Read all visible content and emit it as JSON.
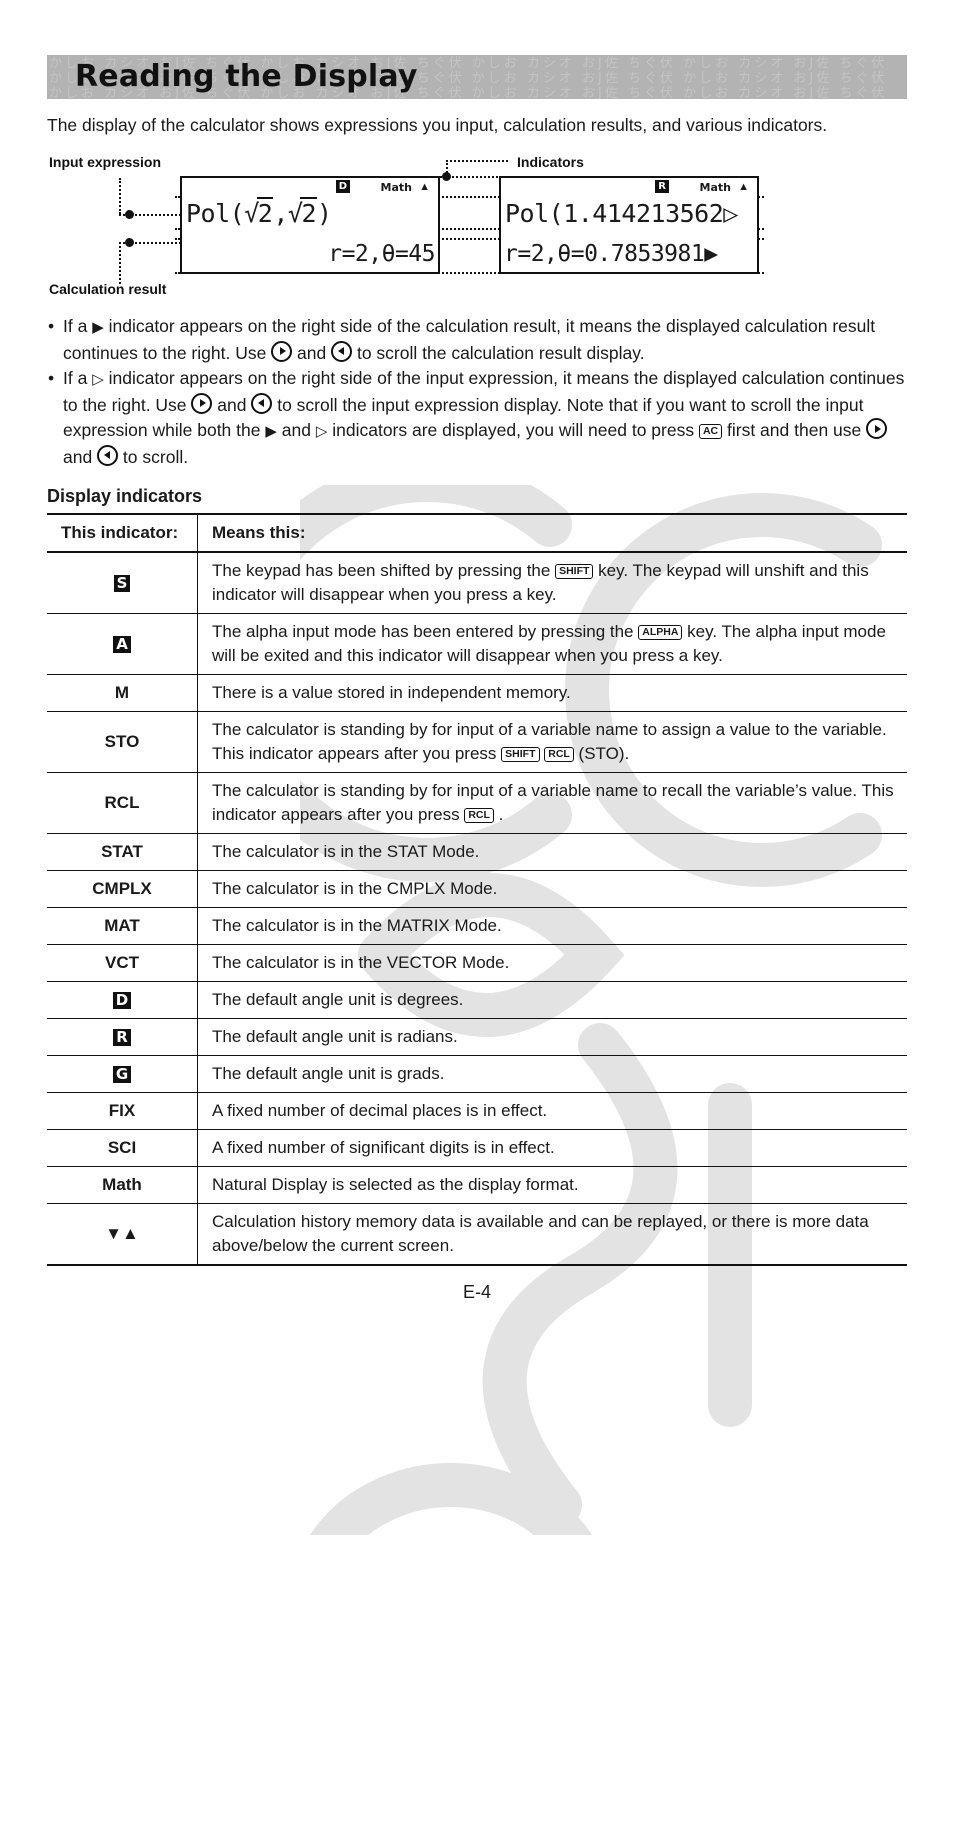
{
  "header": {
    "title": "Reading the Display",
    "kana_pattern": "かしお カシオ おJ佐 ちぐ伏 かしお カシオ おJ佐 ちぐ伏 かしお カシオ おJ佐 ちぐ伏 かしお カシオ おJ佐 ちぐ伏 かしお カシオ おJ佐 ちぐ伏 かしお カシオ おJ佐 ちぐ伏 かしお カシオ おJ佐 ちぐ伏 かしお カシオ おJ佐 ちぐ伏 かしお カシオ おJ佐 ちぐ伏 かしお カシオ おJ佐 ちぐ伏 かしお カシオ おJ佐 ちぐ伏 かしお カシオ おJ佐 ちぐ伏 かしお カシオ おJ佐 ちぐ伏"
  },
  "intro": "The display of the calculator shows expressions you input, calculation results, and various indicators.",
  "figure": {
    "label_input": "Input expression",
    "label_indicators": "Indicators",
    "label_calc_result": "Calculation result",
    "left_display": {
      "angle_indicator": "D",
      "math_indicator": "Math",
      "up_arrow": "▲",
      "expression_prefix": "Pol(",
      "radicand_1": "2",
      "separator": ",",
      "radicand_2": "2",
      "expression_suffix": ")",
      "result": "r=2,θ=45"
    },
    "right_display": {
      "angle_indicator": "R",
      "math_indicator": "Math",
      "up_arrow": "▲",
      "expression": "Pol(1.414213562",
      "expression_scroll_marker": "▷",
      "result": "r=2,θ=0.7853981",
      "result_scroll_marker": "▶"
    }
  },
  "bullets": [
    {
      "parts": [
        {
          "type": "text",
          "value": "If a "
        },
        {
          "type": "glyph",
          "value": "▶"
        },
        {
          "type": "text",
          "value": " indicator appears on the right side of the calculation result, it means the displayed calculation result continues to the right. Use "
        },
        {
          "type": "roundkey",
          "value": "right"
        },
        {
          "type": "text",
          "value": " and "
        },
        {
          "type": "roundkey",
          "value": "left"
        },
        {
          "type": "text",
          "value": " to scroll the calculation result display."
        }
      ]
    },
    {
      "parts": [
        {
          "type": "text",
          "value": "If a "
        },
        {
          "type": "glyph",
          "value": "▷"
        },
        {
          "type": "text",
          "value": " indicator appears on the right side of the input expression, it means the displayed calculation continues to the right. Use "
        },
        {
          "type": "roundkey",
          "value": "right"
        },
        {
          "type": "text",
          "value": " and "
        },
        {
          "type": "roundkey",
          "value": "left"
        },
        {
          "type": "text",
          "value": " to scroll the input expression display. Note that if you want to scroll the input expression while both the "
        },
        {
          "type": "glyph",
          "value": "▶"
        },
        {
          "type": "text",
          "value": " and "
        },
        {
          "type": "glyph",
          "value": "▷"
        },
        {
          "type": "text",
          "value": " indicators are displayed, you will need to press "
        },
        {
          "type": "keycap",
          "value": "AC"
        },
        {
          "type": "text",
          "value": " first and then use "
        },
        {
          "type": "roundkey",
          "value": "right"
        },
        {
          "type": "text",
          "value": " and "
        },
        {
          "type": "roundkey",
          "value": "left"
        },
        {
          "type": "text",
          "value": " to scroll."
        }
      ]
    }
  ],
  "section_heading": "Display indicators",
  "table": {
    "headers": {
      "col1": "This indicator:",
      "col2": "Means this:"
    },
    "rows": [
      {
        "indicator": "S",
        "style": "inverse",
        "meaning_parts": [
          {
            "type": "text",
            "value": "The keypad has been shifted by pressing the "
          },
          {
            "type": "keycap",
            "value": "SHIFT"
          },
          {
            "type": "text",
            "value": " key. The keypad will unshift and this indicator will disappear when you press a key."
          }
        ]
      },
      {
        "indicator": "A",
        "style": "inverse",
        "meaning_parts": [
          {
            "type": "text",
            "value": "The alpha input mode has been entered by pressing the "
          },
          {
            "type": "keycap",
            "value": "ALPHA"
          },
          {
            "type": "text",
            "value": " key. The alpha input mode will be exited and this indicator will disappear when you press a key."
          }
        ]
      },
      {
        "indicator": "M",
        "style": "bold",
        "meaning_parts": [
          {
            "type": "text",
            "value": "There is a value stored in independent memory."
          }
        ]
      },
      {
        "indicator": "STO",
        "style": "bold",
        "meaning_parts": [
          {
            "type": "text",
            "value": "The calculator is standing by for input of a variable name to assign a value to the variable. This indicator appears after you press "
          },
          {
            "type": "keycap",
            "value": "SHIFT"
          },
          {
            "type": "text",
            "value": " "
          },
          {
            "type": "keycap",
            "value": "RCL"
          },
          {
            "type": "text",
            "value": " (STO)."
          }
        ]
      },
      {
        "indicator": "RCL",
        "style": "bold",
        "meaning_parts": [
          {
            "type": "text",
            "value": "The calculator is standing by for input of a variable name to recall the variable’s value. This indicator appears after you press "
          },
          {
            "type": "keycap",
            "value": "RCL"
          },
          {
            "type": "text",
            "value": " ."
          }
        ]
      },
      {
        "indicator": "STAT",
        "style": "bold",
        "meaning_parts": [
          {
            "type": "text",
            "value": "The calculator is in the STAT Mode."
          }
        ]
      },
      {
        "indicator": "CMPLX",
        "style": "bold",
        "meaning_parts": [
          {
            "type": "text",
            "value": "The calculator is in the CMPLX Mode."
          }
        ]
      },
      {
        "indicator": "MAT",
        "style": "bold",
        "meaning_parts": [
          {
            "type": "text",
            "value": "The calculator is in the MATRIX Mode."
          }
        ]
      },
      {
        "indicator": "VCT",
        "style": "bold",
        "meaning_parts": [
          {
            "type": "text",
            "value": "The calculator is in the VECTOR Mode."
          }
        ]
      },
      {
        "indicator": "D",
        "style": "inverse",
        "meaning_parts": [
          {
            "type": "text",
            "value": "The default angle unit is degrees."
          }
        ]
      },
      {
        "indicator": "R",
        "style": "inverse",
        "meaning_parts": [
          {
            "type": "text",
            "value": "The default angle unit is radians."
          }
        ]
      },
      {
        "indicator": "G",
        "style": "inverse",
        "meaning_parts": [
          {
            "type": "text",
            "value": "The default angle unit is grads."
          }
        ]
      },
      {
        "indicator": "FIX",
        "style": "bold",
        "meaning_parts": [
          {
            "type": "text",
            "value": "A fixed number of decimal places is in effect."
          }
        ]
      },
      {
        "indicator": "SCI",
        "style": "bold",
        "meaning_parts": [
          {
            "type": "text",
            "value": "A fixed number of significant digits is in effect."
          }
        ]
      },
      {
        "indicator": "Math",
        "style": "bold",
        "meaning_parts": [
          {
            "type": "text",
            "value": "Natural Display is selected as the display format."
          }
        ]
      },
      {
        "indicator": "▼▲",
        "style": "bold",
        "meaning_parts": [
          {
            "type": "text",
            "value": "Calculation history memory data is available and can be replayed, or there is more data above/below the current screen."
          }
        ]
      }
    ]
  },
  "footer": {
    "page_number": "E-4"
  },
  "colors": {
    "title_band": "#b3b3b3",
    "text": "#1a1a1a",
    "rule": "#111111",
    "watermark": "#e3e3e3"
  }
}
